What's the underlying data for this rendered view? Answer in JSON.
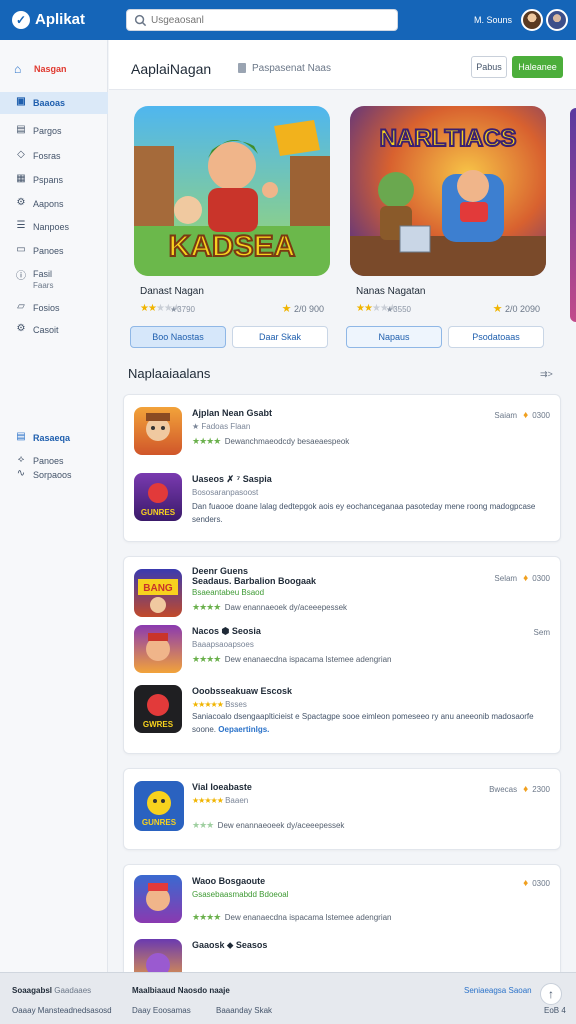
{
  "brand": {
    "name": "Aplikat"
  },
  "search": {
    "placeholder": "Usgeaosanl"
  },
  "user": {
    "name": "M. Souns"
  },
  "sidebar": {
    "home_label": "Nasgan",
    "items": [
      {
        "label": "Baaoas",
        "icon": "grid-icon"
      },
      {
        "label": "Pargos",
        "icon": "chart-icon"
      },
      {
        "label": "Fosras",
        "icon": "diamond-icon"
      },
      {
        "label": "Pspans",
        "icon": "table-icon"
      },
      {
        "label": "Aapons",
        "icon": "gear-icon"
      },
      {
        "label": "Nanpoes",
        "icon": "list-icon"
      },
      {
        "label": "Panoes",
        "icon": "chat-icon"
      },
      {
        "label": "Fasil",
        "label2": "Faars",
        "icon": "info-icon"
      },
      {
        "label": "Fosios",
        "icon": "folder-icon"
      },
      {
        "label": "Casoit",
        "icon": "settings-icon"
      }
    ],
    "section2_label": "Rasaeqa",
    "section2_items": [
      "Panoes",
      "Sorpaoos"
    ]
  },
  "header": {
    "title": "AaplaiNagan",
    "breadcrumb": "Paspasenat Naas",
    "btn_ghost": "Pabus",
    "btn_primary": "Haleanee"
  },
  "featured": [
    {
      "art_title": "KADSEA",
      "name": "Danast Nagan",
      "stars": 2,
      "meta": "★3790",
      "downloads": "2/0 900",
      "btn1": "Boo Naostas",
      "btn2": "Daar Skak"
    },
    {
      "art_title": "NARLTIACS",
      "name": "Nanas Nagatan",
      "stars": 2,
      "meta": "★3550",
      "downloads": "2/0 2090",
      "btn1": "Napaus",
      "btn2": "Psodatoaas"
    }
  ],
  "section": {
    "title": "Naplaaiaalans",
    "more": "⇉>"
  },
  "cards": [
    {
      "rows": [
        {
          "title": "Ajplan Nean Gsabt",
          "sub": "★ Fadoas  Flaan",
          "sub_green": false,
          "rating": "Dewanchmaeodcdy besaeaespeok",
          "stars": 4,
          "desc": "",
          "side_text": "Saiam",
          "side_num": "0300"
        },
        {
          "title": "Uaseos ✗ ⁷ Saspia",
          "sub": "Bososaranpasoost",
          "sub_green": false,
          "rating": "",
          "stars": 0,
          "desc": "Dan fuaooe doane lalag dedtepgok aois ey eochanceganaa pasoteday mene roong madogpcase senders.",
          "side_text": "",
          "side_num": ""
        }
      ]
    },
    {
      "rows": [
        {
          "title": "Deenr Guens",
          "sub": "Bsaeantabeu Bsaod",
          "sub_green": true,
          "rating": "Daw enannaeoek dy/aceeepessek",
          "stars": 4,
          "desc": "",
          "side_text": "Selam",
          "side_num": "0300",
          "pre_title": "Seadaus. Barbalion Boogaak"
        },
        {
          "title": "Nacos ⬢ Seosia",
          "sub": "Baaapsaoapsoes",
          "sub_green": false,
          "rating": "Dew enanaecdna ispacama lstemee adengrian",
          "stars": 4,
          "desc": "",
          "side_text": "Sem",
          "side_num": ""
        },
        {
          "title": "Ooobsseakuaw Escosk",
          "sub": "Bsses",
          "sub_green": false,
          "rating": "",
          "stars": 5,
          "desc": "Saniacoalo dsengaaplticieist e Spactagpe sooe eimleon pomeseeo ry anu aneeonib madosaorfe soone.",
          "desc_link": "Oepaertinlgs.",
          "side_text": "",
          "side_num": ""
        }
      ]
    },
    {
      "rows": [
        {
          "title": "Vial Ioeabaste",
          "sub": "Baaen",
          "sub_green": false,
          "rating": "Dew enannaeoeek dy/aceeepessek",
          "stars": 5,
          "desc": "",
          "side_text": "Bwecas",
          "side_num": "2300"
        }
      ]
    },
    {
      "rows": [
        {
          "title": "Waoo Bosgaoute",
          "sub": "Gsasebaasmabdd Bdoeoal",
          "sub_green": true,
          "rating": "Dew enanaecdna ispacama lstemee adengrian",
          "stars": 4,
          "desc": "",
          "side_text": "",
          "side_num": "0300"
        },
        {
          "title": "Gaaosk ⬥ Seasos",
          "sub": "",
          "sub_green": false,
          "rating": "",
          "stars": 4,
          "desc": "",
          "side_text": "",
          "side_num": ""
        }
      ]
    }
  ],
  "footer": {
    "left1": "Soaagabsl",
    "left1b": "Gaadaaes",
    "left2": "Oaaay Mansteadnedsasosd",
    "mid1": "Maalbiaaud Naosdo naaje",
    "mid2a": "Daay Eoosamas",
    "mid2b": "Baaanday Skak",
    "right1": "Seniaeagsa Saoan",
    "right2": "EoB 4"
  }
}
